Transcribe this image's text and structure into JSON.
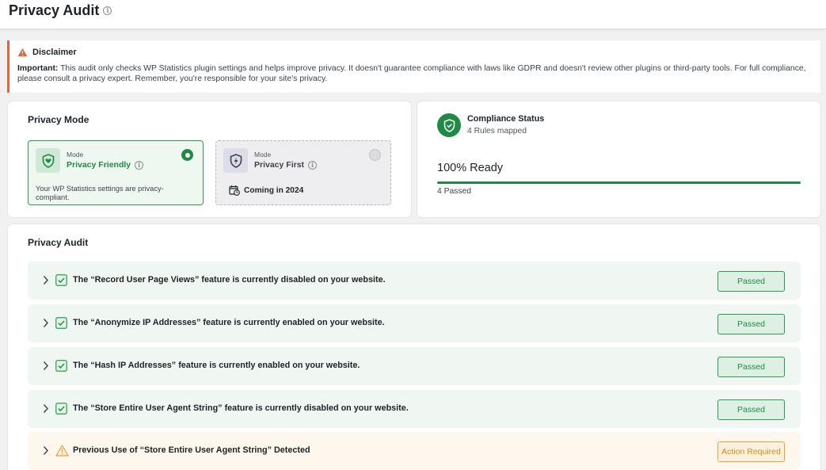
{
  "header": {
    "title": "Privacy Audit",
    "info_icon": "info-circle-icon"
  },
  "disclaimer": {
    "icon": "warning-triangle-icon",
    "title": "Disclaimer",
    "important_label": "Important:",
    "text": "This audit only checks WP Statistics plugin settings and helps improve privacy. It doesn't guarantee compliance with laws like GDPR and doesn't review other plugins or third-party tools. For full compliance, please consult a privacy expert. Remember, you're responsible for your site's privacy.",
    "accent_color": "#e0663c"
  },
  "privacy_mode": {
    "title": "Privacy Mode",
    "options": [
      {
        "small_label": "Mode",
        "name": "Privacy Friendly",
        "description": "Your WP Statistics settings are privacy-compliant.",
        "selected": true,
        "icon": "shield-heart-icon"
      },
      {
        "small_label": "Mode",
        "name": "Privacy First",
        "coming_text": "Coming in 2024",
        "selected": false,
        "icon": "shield-bolt-icon",
        "coming_icon": "calendar-clock-icon"
      }
    ]
  },
  "compliance": {
    "title": "Compliance Status",
    "subtitle": "4 Rules mapped",
    "ready_text": "100% Ready",
    "progress_fraction": 1.0,
    "passed_text": "4 Passed",
    "icon": "shield-check-icon",
    "accent_color": "#1f8a43"
  },
  "audit": {
    "title": "Privacy Audit",
    "items": [
      {
        "text": "The “Record User Page Views” feature is currently disabled on your website.",
        "status": "Passed",
        "kind": "ok"
      },
      {
        "text": "The “Anonymize IP Addresses” feature is currently enabled on your website.",
        "status": "Passed",
        "kind": "ok"
      },
      {
        "text": "The “Hash IP Addresses” feature is currently enabled on your website.",
        "status": "Passed",
        "kind": "ok"
      },
      {
        "text": "The “Store Entire User Agent String” feature is currently disabled on your website.",
        "status": "Passed",
        "kind": "ok"
      },
      {
        "text": "Previous Use of “Store Entire User Agent String” Detected",
        "status": "Action Required",
        "kind": "warn"
      }
    ]
  }
}
